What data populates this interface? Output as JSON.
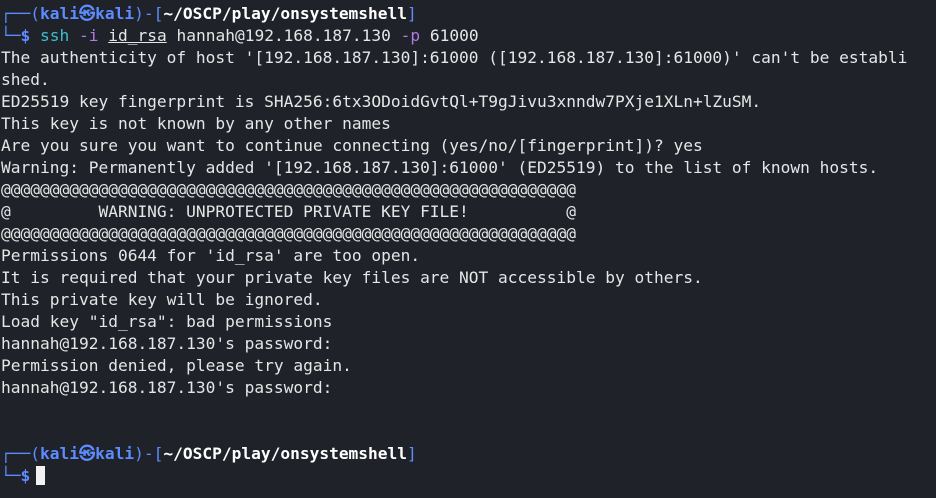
{
  "prompt1": {
    "corner": "┌──(",
    "user": "kali",
    "at_icon": "㉿",
    "host": "kali",
    "sep": ")-[",
    "path": "~/OSCP/play/onsystemshell",
    "close": "]",
    "arrow": "└─",
    "dollar": "$",
    "cmd": "ssh",
    "flag_i": "-i",
    "keyfile": "id_rsa",
    "target": "hannah@192.168.187.130",
    "flag_p": "-p",
    "port": "61000"
  },
  "output": [
    "The authenticity of host '[192.168.187.130]:61000 ([192.168.187.130]:61000)' can't be establi",
    "shed.",
    "ED25519 key fingerprint is SHA256:6tx3ODoidGvtQl+T9gJivu3xnndw7PXje1XLn+lZuSM.",
    "This key is not known by any other names",
    "Are you sure you want to continue connecting (yes/no/[fingerprint])? yes",
    "Warning: Permanently added '[192.168.187.130]:61000' (ED25519) to the list of known hosts.",
    "@@@@@@@@@@@@@@@@@@@@@@@@@@@@@@@@@@@@@@@@@@@@@@@@@@@@@@@@@@@",
    "@         WARNING: UNPROTECTED PRIVATE KEY FILE!          @",
    "@@@@@@@@@@@@@@@@@@@@@@@@@@@@@@@@@@@@@@@@@@@@@@@@@@@@@@@@@@@",
    "Permissions 0644 for 'id_rsa' are too open.",
    "It is required that your private key files are NOT accessible by others.",
    "This private key will be ignored.",
    "Load key \"id_rsa\": bad permissions",
    "hannah@192.168.187.130's password: ",
    "Permission denied, please try again.",
    "hannah@192.168.187.130's password: "
  ],
  "prompt2": {
    "corner": "┌──(",
    "user": "kali",
    "at_icon": "㉿",
    "host": "kali",
    "sep": ")-[",
    "path": "~/OSCP/play/onsystemshell",
    "close": "]",
    "arrow": "└─",
    "dollar": "$"
  },
  "colors": {
    "background": "#1f2229",
    "prompt_blue": "#5c8cff",
    "command_cyan": "#3fbfd0",
    "flag_purple": "#b07adf",
    "text": "#e6e6e6"
  }
}
